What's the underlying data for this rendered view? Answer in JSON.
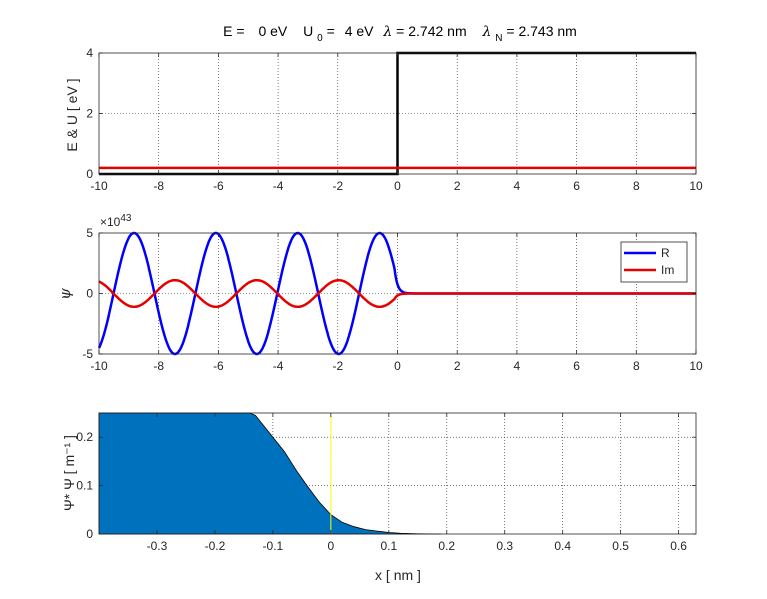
{
  "figure": {
    "title": {
      "E_label": "E = ",
      "E_value": "0 eV",
      "U_label": "U",
      "U_sub": "0",
      "U_eq": " = ",
      "U_value": "4 eV",
      "lambda_sym": "λ",
      "lambda_value": " = 2.742 nm",
      "lambdaN_sym": "λ",
      "lambdaN_sub": "N",
      "lambdaN_value": " = 2.743 nm"
    }
  },
  "colors": {
    "potential": "#000000",
    "energy": "#e60000",
    "real": "#0000ff",
    "imag": "#e60000",
    "fill": "#0072bd",
    "marker": "#ffff00"
  },
  "chart_data": [
    {
      "type": "line",
      "ylabel": "E & U  [ eV ]",
      "xlim": [
        -10,
        10
      ],
      "ylim": [
        0,
        4
      ],
      "xticks": [
        -10,
        -8,
        -6,
        -4,
        -2,
        0,
        2,
        4,
        6,
        8,
        10
      ],
      "yticks": [
        0,
        2,
        4
      ],
      "grid": true,
      "series": [
        {
          "x": [
            -10,
            0,
            0,
            10
          ],
          "y": [
            0,
            0,
            4,
            4
          ]
        },
        {
          "x": [
            -10,
            10
          ],
          "y": [
            0.2,
            0.2
          ]
        }
      ]
    },
    {
      "type": "line",
      "ylabel": "ψ",
      "y_exponent": "43",
      "xlim": [
        -10,
        10
      ],
      "ylim": [
        -5,
        5
      ],
      "xticks": [
        -10,
        -8,
        -6,
        -4,
        -2,
        0,
        2,
        4,
        6,
        8,
        10
      ],
      "yticks": [
        -5,
        0,
        5
      ],
      "grid": true,
      "legend": "top-right",
      "wavelength": 2.742,
      "barrier_x": 0,
      "decay_length": 0.1,
      "series": [
        {
          "name": "R",
          "amplitude": 5.0,
          "phase_point": -0.6
        },
        {
          "name": "Im",
          "amplitude": 1.1,
          "phase_point": -0.6
        }
      ]
    },
    {
      "type": "area",
      "xlabel": "x  [ nm ]",
      "ylabel": "Ψ* Ψ  [ m⁻¹ ]",
      "xlim": [
        -0.4,
        0.63
      ],
      "ylim": [
        0,
        0.25
      ],
      "xticks": [
        -0.3,
        -0.2,
        -0.1,
        0,
        0.1,
        0.2,
        0.3,
        0.4,
        0.5,
        0.6
      ],
      "xtick_labels": [
        "-0.3",
        "-0.2",
        "-0.1",
        "0",
        "0.1",
        "0.2",
        "0.3",
        "0.4",
        "0.5",
        "0.6"
      ],
      "yticks": [
        0,
        0.1,
        0.2
      ],
      "ytick_labels": [
        "0",
        "0.1",
        "0.2"
      ],
      "grid": true,
      "marker_x": 0,
      "x": [
        -0.4,
        -0.14,
        -0.13,
        -0.1,
        -0.08,
        -0.06,
        -0.04,
        -0.02,
        0,
        0.02,
        0.04,
        0.06,
        0.08,
        0.1,
        0.12,
        0.15,
        0.19
      ],
      "y": [
        0.25,
        0.25,
        0.245,
        0.2,
        0.17,
        0.132,
        0.098,
        0.066,
        0.04,
        0.024,
        0.015,
        0.009,
        0.006,
        0.003,
        0.0015,
        0.0005,
        0
      ]
    }
  ]
}
